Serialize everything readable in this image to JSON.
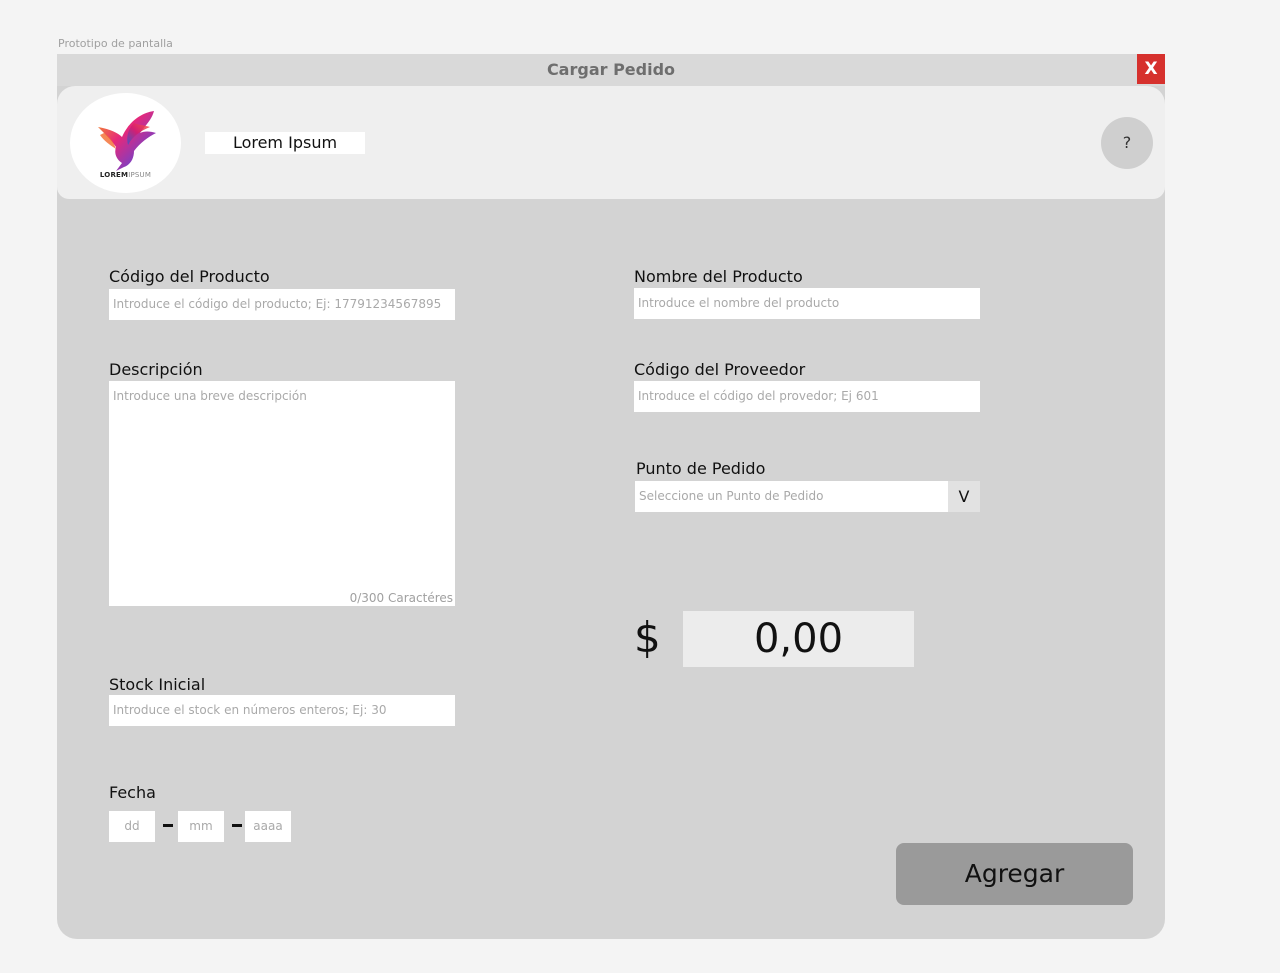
{
  "prototype_label": "Prototipo de pantalla",
  "window": {
    "title": "Cargar Pedido",
    "close_label": "X"
  },
  "header": {
    "logo_text_bold": "LOREM",
    "logo_text_thin": "IPSUM",
    "user_name": "Lorem Ipsum",
    "help_label": "?"
  },
  "form": {
    "codigo_producto": {
      "label": "Código del Producto",
      "placeholder": "Introduce el código del producto; Ej: 17791234567895"
    },
    "nombre_producto": {
      "label": "Nombre del Producto",
      "placeholder": "Introduce el nombre del producto"
    },
    "descripcion": {
      "label": "Descripción",
      "placeholder": "Introduce una breve descripción",
      "char_count": "0/300 Caractéres"
    },
    "codigo_proveedor": {
      "label": "Código del Proveedor",
      "placeholder": "Introduce el código del provedor; Ej 601"
    },
    "punto_pedido": {
      "label": "Punto de Pedido",
      "placeholder": "Seleccione un Punto de Pedido",
      "arrow": "V"
    },
    "precio": {
      "symbol": "$",
      "value": "0,00"
    },
    "stock_inicial": {
      "label": "Stock Inicial",
      "placeholder": "Introduce el stock en números enteros; Ej: 30"
    },
    "fecha": {
      "label": "Fecha",
      "dd": "dd",
      "mm": "mm",
      "aaaa": "aaaa"
    },
    "submit_label": "Agregar"
  }
}
